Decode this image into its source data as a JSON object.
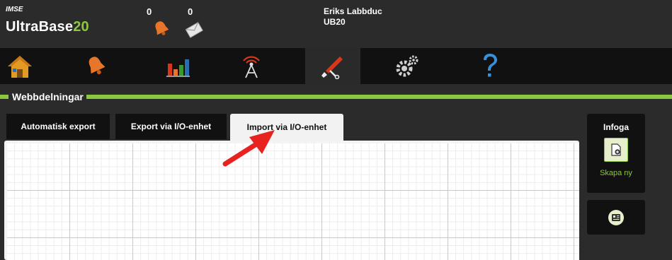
{
  "header": {
    "brand_top": "IMSE",
    "brand_main": "UltraBase",
    "brand_accent": "20",
    "alarm_count": "0",
    "message_count": "0",
    "user_name": "Eriks Labbduc",
    "user_sub": "UB20"
  },
  "nav": {
    "items": [
      {
        "icon": "home-icon"
      },
      {
        "icon": "bell-icon"
      },
      {
        "icon": "bar-chart-icon"
      },
      {
        "icon": "antenna-icon"
      },
      {
        "icon": "tools-icon",
        "active": true
      },
      {
        "icon": "gears-icon"
      },
      {
        "icon": "question-icon"
      }
    ]
  },
  "section": {
    "title": "Webbdelningar"
  },
  "tabs": [
    {
      "label": "Automatisk export"
    },
    {
      "label": "Export via I/O-enhet"
    },
    {
      "label": "Import via I/O-enhet",
      "active": true
    }
  ],
  "sidebar": {
    "title": "Infoga",
    "create_label": "Skapa ny"
  },
  "colors": {
    "accent": "#8dc63f",
    "header_bg": "#2b2b2b",
    "nav_bg": "#111111",
    "annotation_arrow": "#e8231f"
  }
}
